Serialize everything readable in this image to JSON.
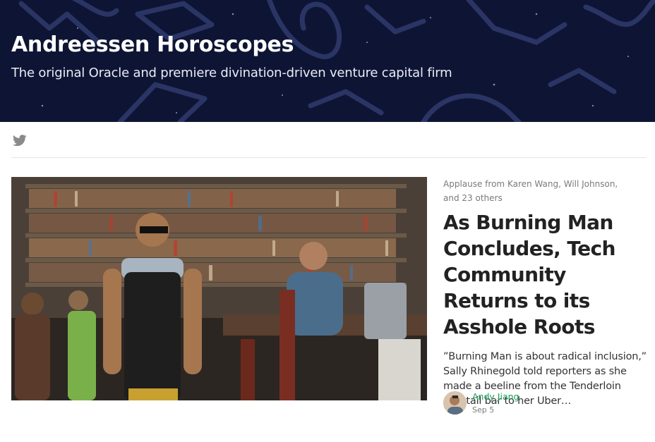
{
  "publication": {
    "title": "Andreessen Horoscopes",
    "tagline": "The original Oracle and premiere divination-driven venture capital firm"
  },
  "social": {
    "icons": [
      "twitter-icon"
    ]
  },
  "post": {
    "applause_prefix": "Applause from ",
    "applause_names": "Karen Wang, Will Johnson,",
    "applause_suffix": "and 23 others",
    "headline": "As Burning Man Concludes, Tech Community Returns to its Asshole Roots",
    "excerpt": "”Burning Man is about radical inclusion,” Sally Rhinegold told reporters as she made a beeline from the Tenderloin cocktail bar to her Uber…",
    "author": "Andy Jiang",
    "date": "Sep 5"
  },
  "colors": {
    "hero_background": "#0e1534",
    "author_link": "#1a9a5a",
    "text_muted": "#7a7a7a"
  }
}
